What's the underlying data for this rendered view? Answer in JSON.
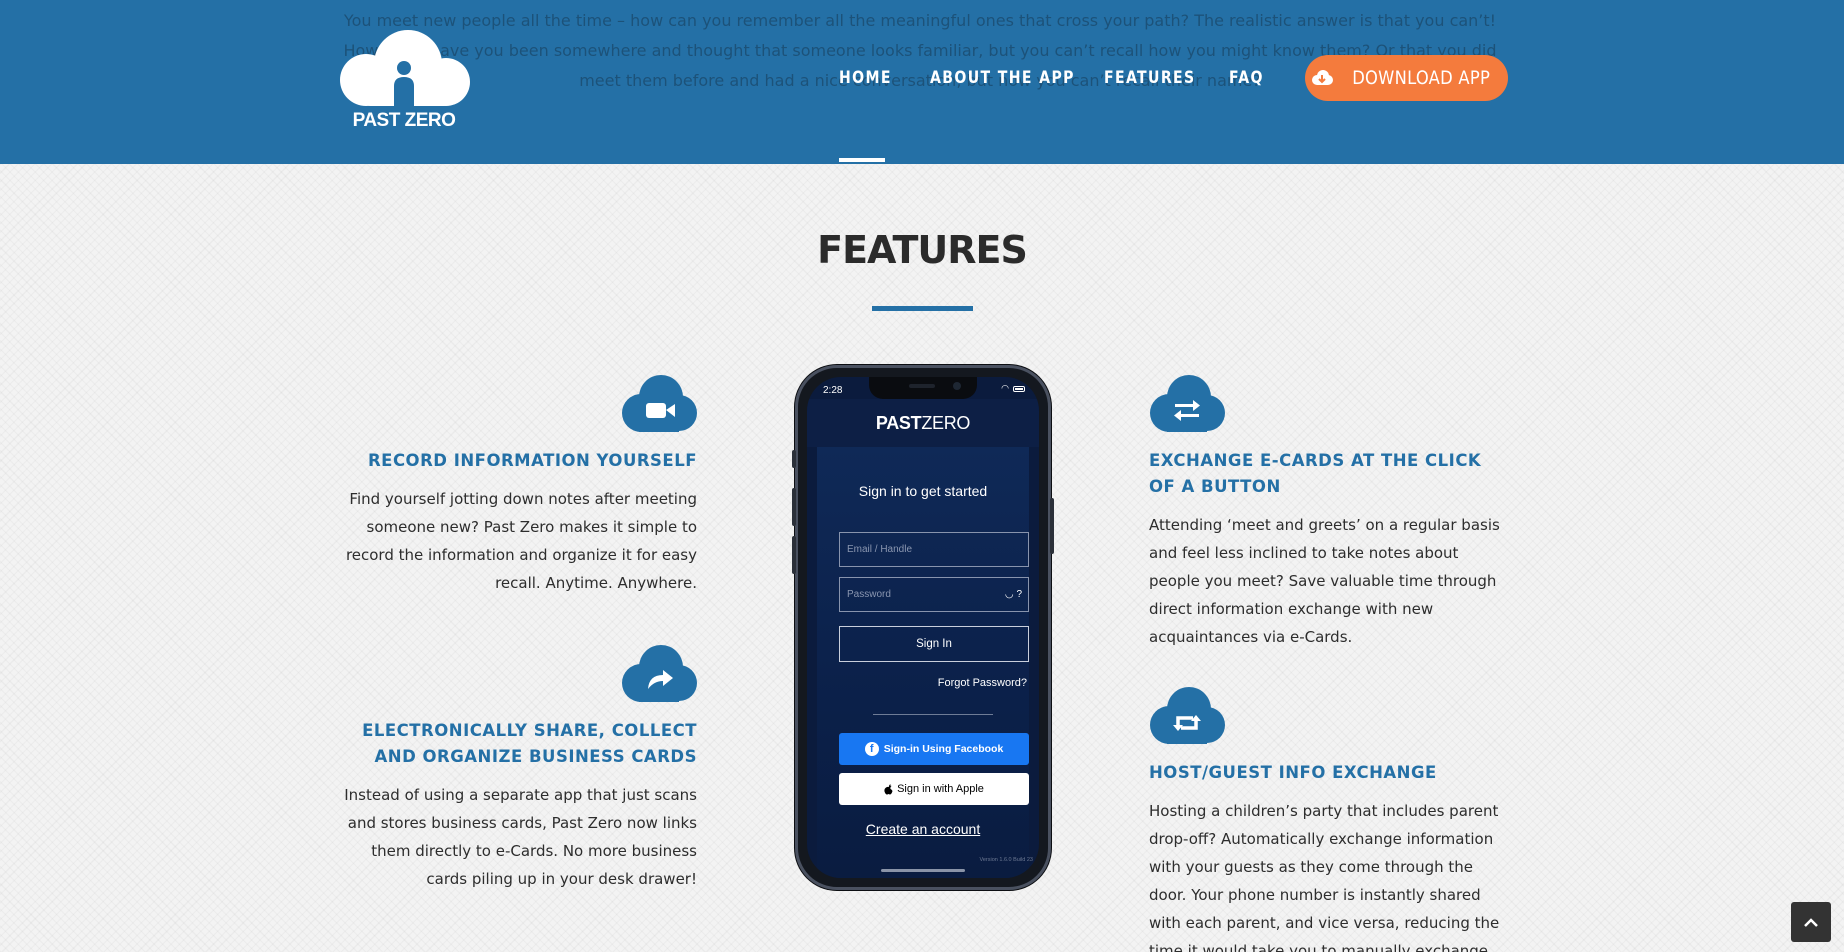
{
  "header": {
    "intro_text": "You meet new people all the time – how can you remember all the meaningful ones that cross your path? The realistic answer is that you can’t! How often have you been somewhere and thought that someone looks familiar, but you can’t recall how you might know them? Or that you did meet them before and had a nice conversation, but now you can’t recall their name?",
    "logo_text": "PAST ZERO",
    "nav": [
      {
        "label": "HOME",
        "active": true
      },
      {
        "label": "ABOUT THE APP",
        "active": false
      },
      {
        "label": "FEATURES",
        "active": false
      },
      {
        "label": "FAQ",
        "active": false
      }
    ],
    "download_label": "DOWNLOAD APP"
  },
  "colors": {
    "brand_blue": "#2470a6",
    "accent_orange": "#f47b3d",
    "heading_text": "#2b2b2b"
  },
  "section": {
    "title": "FEATURES"
  },
  "features": {
    "left": [
      {
        "icon": "video-camera-icon",
        "title": "RECORD INFORMATION YOURSELF",
        "body": "Find yourself jotting down notes after meeting someone new?  Past Zero makes it simple to record the information and organize it for easy recall.  Anytime.  Anywhere."
      },
      {
        "icon": "share-arrow-icon",
        "title": "ELECTRONICALLY SHARE, COLLECT AND ORGANIZE BUSINESS CARDS",
        "body": "Instead of using a separate app that just scans and stores business cards, Past Zero now links them directly to e-Cards.  No more business cards piling up in your desk drawer!"
      }
    ],
    "right": [
      {
        "icon": "exchange-arrows-icon",
        "title": "EXCHANGE E-CARDS AT THE CLICK OF A BUTTON",
        "body": "Attending ‘meet and greets’ on a regular basis and feel less inclined to take notes about people you meet?  Save valuable time through direct information exchange with new acquaintances via e-Cards."
      },
      {
        "icon": "retweet-icon",
        "title": "HOST/GUEST INFO EXCHANGE",
        "body": "Hosting a children’s party that includes parent drop-off?  Automatically exchange information with your guests as they come through the door.  Your phone number is instantly shared with each parent, and vice versa, reducing the time it would take you to manually exchange information from more than a"
      }
    ]
  },
  "phone": {
    "status_time": "2:28",
    "app_name_bold": "PAST",
    "app_name_light": "ZERO",
    "signin_title": "Sign in to get started",
    "email_placeholder": "Email / Handle",
    "password_placeholder": "Password",
    "password_help": "?",
    "signin_button": "Sign In",
    "forgot_password": "Forgot Password?",
    "facebook_button": "Sign-in Using Facebook",
    "apple_button": "Sign in with Apple",
    "create_account": "Create an account",
    "version": "Version 1.6.0 Build 23"
  },
  "scroll_top": {
    "icon": "chevron-up-icon"
  }
}
